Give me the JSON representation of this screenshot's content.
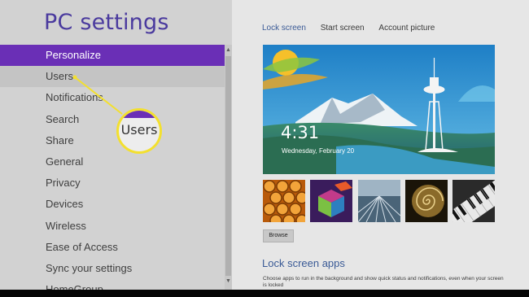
{
  "app": {
    "title": "PC settings"
  },
  "sidebar": {
    "items": [
      {
        "label": "Personalize",
        "state": "selected"
      },
      {
        "label": "Users",
        "state": "hover"
      },
      {
        "label": "Notifications",
        "state": "normal"
      },
      {
        "label": "Search",
        "state": "normal"
      },
      {
        "label": "Share",
        "state": "normal"
      },
      {
        "label": "General",
        "state": "normal"
      },
      {
        "label": "Privacy",
        "state": "normal"
      },
      {
        "label": "Devices",
        "state": "normal"
      },
      {
        "label": "Wireless",
        "state": "normal"
      },
      {
        "label": "Ease of Access",
        "state": "normal"
      },
      {
        "label": "Sync your settings",
        "state": "normal"
      },
      {
        "label": "HomeGroup",
        "state": "normal"
      }
    ]
  },
  "tabs": [
    {
      "label": "Lock screen",
      "active": true
    },
    {
      "label": "Start screen",
      "active": false
    },
    {
      "label": "Account picture",
      "active": false
    }
  ],
  "lock_preview": {
    "time": "4:31",
    "date": "Wednesday, February 20"
  },
  "thumbnails": [
    "honeycomb",
    "abstract-cubes",
    "railway-tracks",
    "nautilus-shell",
    "piano-keys"
  ],
  "browse_label": "Browse",
  "lock_apps": {
    "title": "Lock screen apps",
    "description": "Choose apps to run in the background and show quick status and notifications, even when your screen is locked"
  },
  "callout": {
    "label": "Users"
  },
  "colors": {
    "accent": "#6a2fb6",
    "highlight": "#f3e02f",
    "link": "#3a5a96"
  }
}
